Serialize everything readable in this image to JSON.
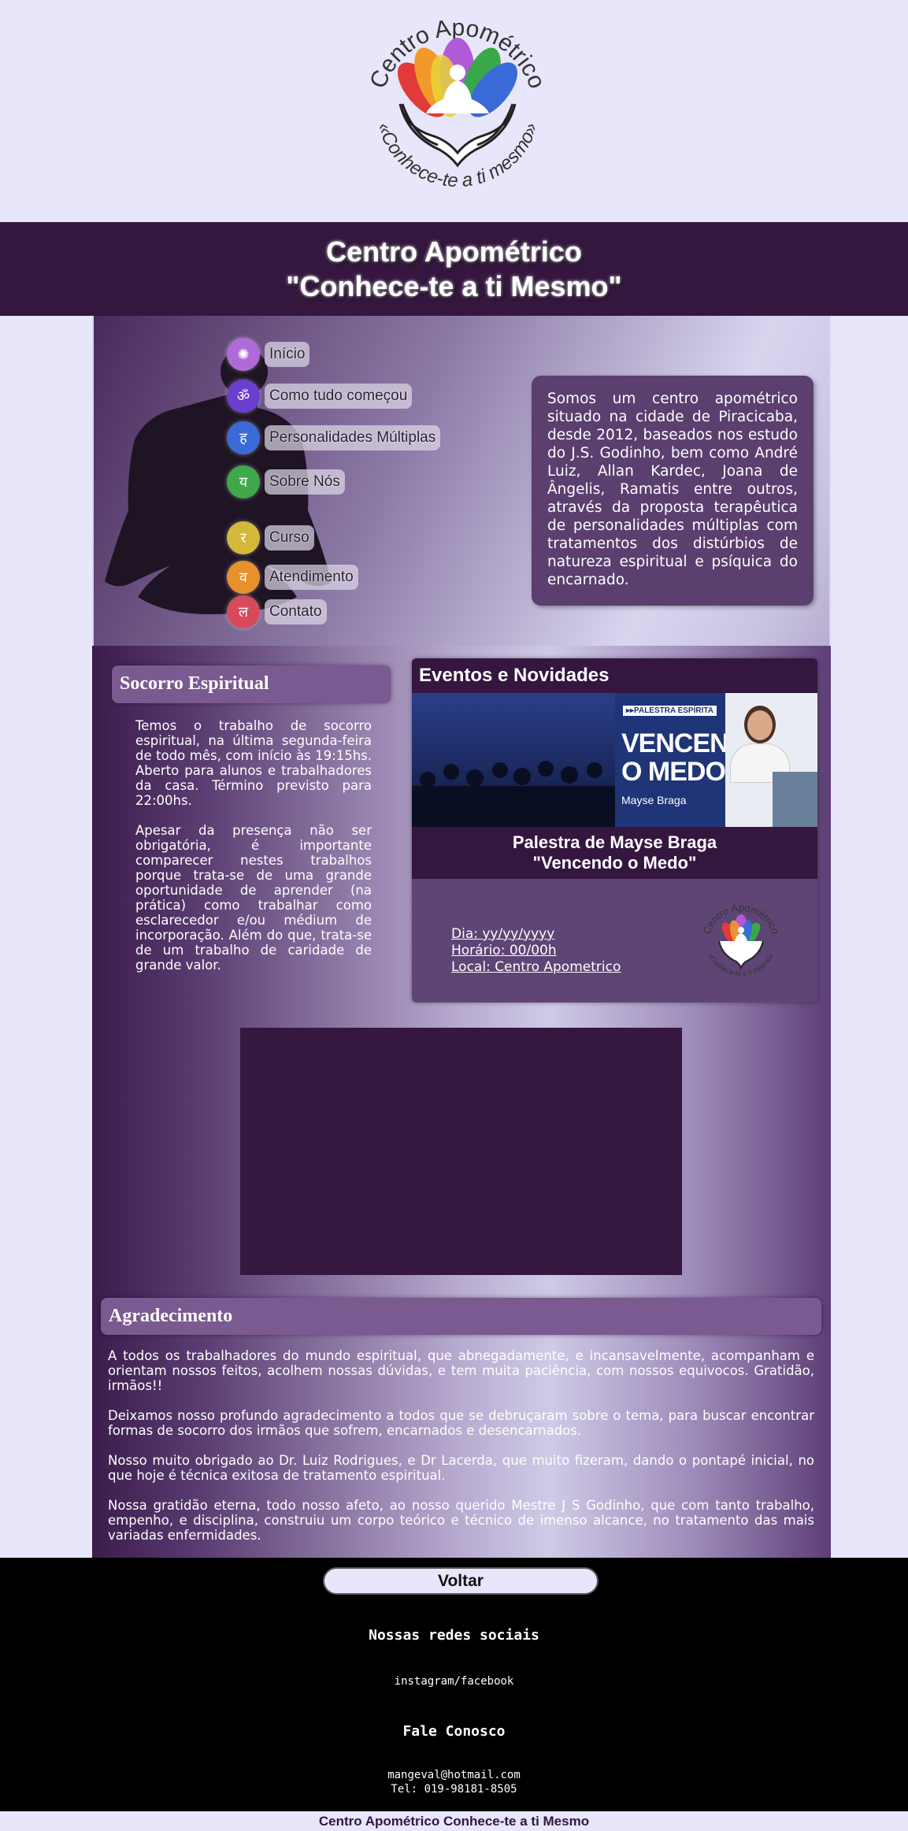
{
  "logo": {
    "top_text": "Centro Apométrico",
    "bottom_text": "«Conhece-te a ti mesmo»"
  },
  "banner": {
    "line1": "Centro Apométrico",
    "line2": "\"Conhece-te a ti Mesmo\""
  },
  "nav": [
    {
      "label": "Início",
      "symbol": "✺",
      "color": "#b06ad8"
    },
    {
      "label": "Como tudo começou",
      "symbol": "ॐ",
      "color": "#6a3fd0"
    },
    {
      "label": "Personalidades Múltiplas",
      "symbol": "ह",
      "color": "#3a6ad8"
    },
    {
      "label": "Sobre Nós",
      "symbol": "य",
      "color": "#3fa84a"
    },
    {
      "label": "Curso",
      "symbol": "र",
      "color": "#d4b83a"
    },
    {
      "label": "Atendimento",
      "symbol": "व",
      "color": "#e8902a"
    },
    {
      "label": "Contato",
      "symbol": "ल",
      "color": "#d84a5a"
    }
  ],
  "about": "Somos um centro apométrico situado na cidade de Piracicaba, desde 2012, baseados nos estudo do J.S. Godinho, bem como André Luiz, Allan Kardec, Joana de Ângelis, Ramatis entre outros, através da proposta terapêutica de personalidades múltiplas com tratamentos dos distúrbios de natureza espiritual e psíquica do encarnado.",
  "socorro": {
    "title": "Socorro Espiritual",
    "p1": "Temos o trabalho de socorro espiritual, na última segunda-feira de todo mês, com início às 19:15hs. Aberto para alunos e trabalhadores da casa. Término previsto para 22:00hs.",
    "p2": "Apesar da presença não ser obrigatória, é importante comparecer nestes trabalhos porque trata-se de uma grande oportunidade de aprender (na prática) como trabalhar como esclarecedor e/ou médium de incorporação. Além do que, trata-se de um trabalho de caridade de grande valor."
  },
  "events": {
    "title": "Eventos e Novidades",
    "poster_tag": "▸▸PALESTRA ESPÍRITA",
    "poster_title1": "VENCENDO",
    "poster_title2": "O MEDO",
    "poster_speaker": "Mayse Braga",
    "caption1": "Palestra de Mayse Braga",
    "caption2": "\"Vencendo o Medo\"",
    "date": "Dia: yy/yy/yyyy",
    "time": "Horário: 00/00h",
    "place": "Local: Centro Apometrico",
    "logo_top": "Centro Apométrico",
    "logo_bottom": "«Conhece-te a ti mesmo»"
  },
  "agradecimento": {
    "title": "Agradecimento",
    "p1": "A todos os trabalhadores do mundo espiritual, que abnegadamente, e incansavelmente, acompanham e orientam nossos feitos, acolhem nossas dúvidas, e tem muita paciência, com nossos equivocos. Gratidão, irmãos!!",
    "p2": "Deixamos nosso profundo agradecimento a todos que se debruçaram sobre o tema, para buscar encontrar formas de socorro dos irmãos que sofrem, encarnados e desencarnados.",
    "p3": "Nosso muito obrigado ao Dr. Luiz Rodrigues, e Dr Lacerda, que muito fizeram, dando o pontapé inicial, no que hoje é técnica exitosa de tratamento espiritual.",
    "p4": "Nossa gratidão eterna, todo nosso afeto, ao nosso querido Mestre J S Godinho, que com tanto trabalho, empenho, e disciplina, construiu um corpo teórico e técnico de imenso alcance, no tratamento das mais variadas enfermidades."
  },
  "footer": {
    "back": "Voltar",
    "social_title": "Nossas redes sociais",
    "social": "instagram/facebook",
    "contact_title": "Fale Conosco",
    "email": "mangeval@hotmail.com",
    "phone": "Tel: 019-98181-8505"
  },
  "bottom_bar": "Centro Apométrico Conhece-te a ti Mesmo"
}
